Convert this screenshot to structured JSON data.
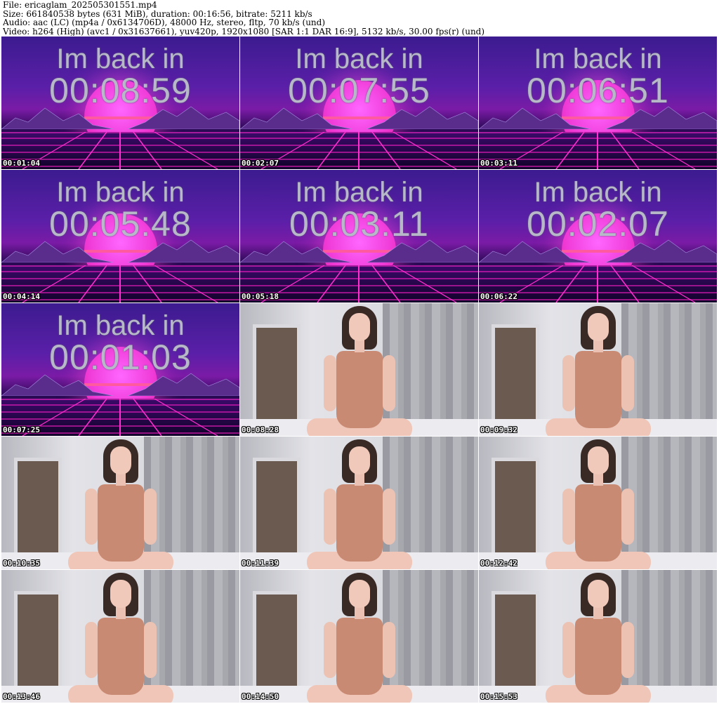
{
  "header": {
    "file_line": "File: ericaglam_202505301551.mp4",
    "size_line": "Size: 661840538 bytes (631 MiB), duration: 00:16:56, bitrate: 5211 kb/s",
    "audio_line": "Audio: aac (LC) (mp4a / 0x6134706D), 48000 Hz, stereo, fltp, 70 kb/s (und)",
    "video_line": "Video: h264 (High) (avc1 / 0x31637661), yuv420p, 1920x1080 [SAR 1:1 DAR 16:9], 5132 kb/s, 30.00 fps(r) (und)"
  },
  "thumbnails": [
    {
      "timestamp": "00:01:04",
      "kind": "countdown",
      "line1": "Im back in",
      "line2": "00:08:59"
    },
    {
      "timestamp": "00:02:07",
      "kind": "countdown",
      "line1": "Im back in",
      "line2": "00:07:55"
    },
    {
      "timestamp": "00:03:11",
      "kind": "countdown",
      "line1": "Im back in",
      "line2": "00:06:51"
    },
    {
      "timestamp": "00:04:14",
      "kind": "countdown",
      "line1": "Im back in",
      "line2": "00:05:48"
    },
    {
      "timestamp": "00:05:18",
      "kind": "countdown",
      "line1": "Im back in",
      "line2": "00:03:11"
    },
    {
      "timestamp": "00:06:22",
      "kind": "countdown",
      "line1": "Im back in",
      "line2": "00:02:07"
    },
    {
      "timestamp": "00:07:25",
      "kind": "countdown",
      "line1": "Im back in",
      "line2": "00:01:03"
    },
    {
      "timestamp": "00:08:28",
      "kind": "photo"
    },
    {
      "timestamp": "00:09:32",
      "kind": "photo"
    },
    {
      "timestamp": "00:10:35",
      "kind": "photo"
    },
    {
      "timestamp": "00:11:39",
      "kind": "photo"
    },
    {
      "timestamp": "00:12:42",
      "kind": "photo"
    },
    {
      "timestamp": "00:13:46",
      "kind": "photo"
    },
    {
      "timestamp": "00:14:50",
      "kind": "photo"
    },
    {
      "timestamp": "00:15:53",
      "kind": "photo"
    }
  ],
  "colors": {
    "background": "#ffffff",
    "header_text": "#000000",
    "timestamp_text": "#ffffff",
    "countdown_text": "#b7b8c8",
    "sun": "#f03cd8"
  }
}
